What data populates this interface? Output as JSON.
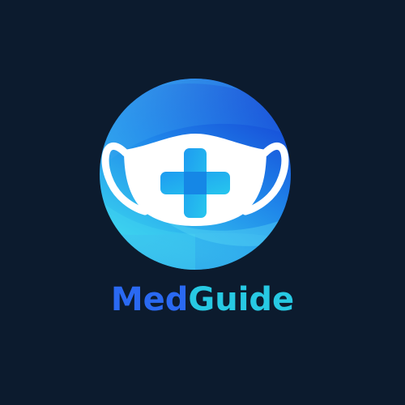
{
  "brand": {
    "name_part_1": "Med",
    "name_part_2": "Guide",
    "colors": {
      "background": "#0c1b2e",
      "name_part_1": "#2a69f2",
      "name_part_2": "#27c9e3",
      "circle_dark": "#1b4fd8",
      "circle_light": "#35d2ee",
      "mask": "#ffffff",
      "cross": "#1fb0ec"
    }
  },
  "logo": {
    "emblem_icon": "face-mask-icon",
    "cross_icon": "medical-cross-icon"
  }
}
